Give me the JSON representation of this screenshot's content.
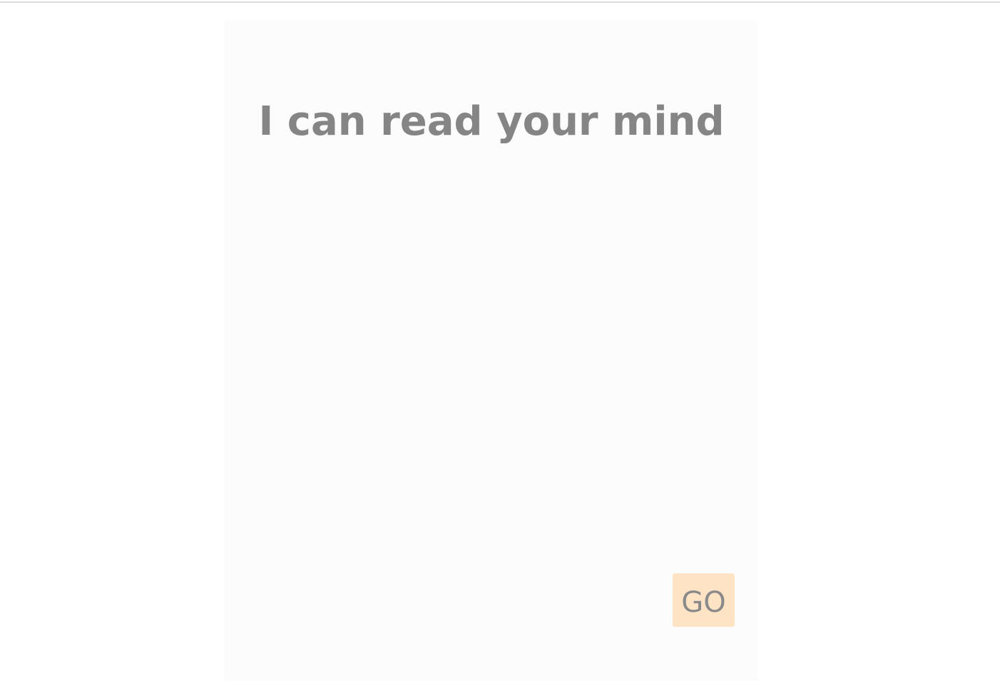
{
  "heading": "I can read your mind",
  "go_button_label": "GO",
  "colors": {
    "page_background": "#ffffff",
    "card_background": "#fcfcfc",
    "heading_text": "#858585",
    "button_background": "#fee4c5",
    "button_text": "#8a8a8a",
    "top_rule": "#dcdcdc"
  }
}
